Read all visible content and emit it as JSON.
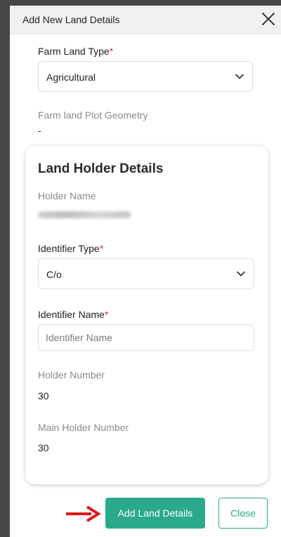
{
  "modal": {
    "title": "Add New Land Details"
  },
  "farm": {
    "land_type_label": "Farm Land Type",
    "required_mark": "*",
    "land_type_value": "Agricultural",
    "geometry_label": "Farm land Plot Geometry",
    "geometry_value": "-"
  },
  "holder": {
    "section_title": "Land Holder Details",
    "name_label": "Holder Name",
    "identifier_type_label": "Identifier Type",
    "identifier_type_value": "C/o",
    "identifier_name_label": "Identifier Name",
    "identifier_name_value": "",
    "identifier_name_placeholder": "Identifier Name",
    "holder_number_label": "Holder Number",
    "holder_number_value": "30",
    "main_holder_number_label": "Main Holder Number",
    "main_holder_number_value": "30"
  },
  "footer": {
    "add_button": "Add Land Details",
    "close_button": "Close"
  },
  "colors": {
    "accent": "#2aaa8a",
    "required": "#d32f2f",
    "arrow": "#e0151b"
  },
  "icons": {
    "close": "close-icon",
    "dropdown": "chevron-down-icon",
    "pointer": "arrow-right-icon"
  }
}
